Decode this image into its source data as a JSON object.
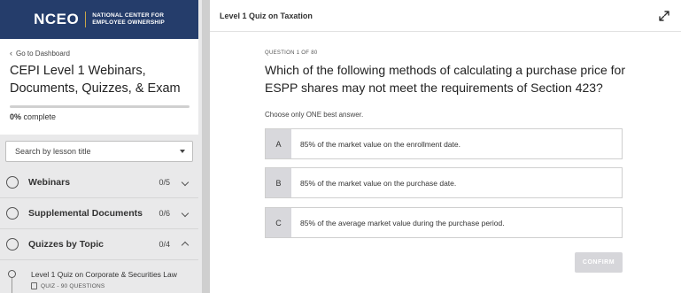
{
  "brand": {
    "logo": "NCEO",
    "tagline_line1": "NATIONAL CENTER FOR",
    "tagline_line2": "EMPLOYEE OWNERSHIP",
    "bg_color": "#253d6b",
    "divider_color": "#c9a74a"
  },
  "course": {
    "back_link": "Go to Dashboard",
    "title": "CEPI Level 1 Webinars, Documents, Quizzes, & Exam",
    "progress_value": "0%",
    "progress_suffix": "complete",
    "progress_fraction": 0
  },
  "search": {
    "placeholder": "Search by lesson title"
  },
  "sections": [
    {
      "label": "Webinars",
      "count": "0/5",
      "expanded": false
    },
    {
      "label": "Supplemental Documents",
      "count": "0/6",
      "expanded": false
    },
    {
      "label": "Quizzes by Topic",
      "count": "0/4",
      "expanded": true
    }
  ],
  "lesson": {
    "title": "Level 1 Quiz on Corporate & Securities Law",
    "meta": "QUIZ - 90 QUESTIONS",
    "icon": "document-icon"
  },
  "main": {
    "quiz_title": "Level 1 Quiz on Taxation",
    "question_counter": "QUESTION 1 OF 80",
    "question_text": "Which of the following methods of calculating a purchase price for ESPP shares may not meet the requirements of Section 423?",
    "instruction": "Choose only ONE best answer.",
    "options": [
      {
        "letter": "A",
        "text": "85% of the market value on the enrollment date."
      },
      {
        "letter": "B",
        "text": "85% of the market value on the purchase date."
      },
      {
        "letter": "C",
        "text": "85% of the average market value during the purchase period."
      }
    ],
    "confirm_label": "CONFIRM"
  }
}
